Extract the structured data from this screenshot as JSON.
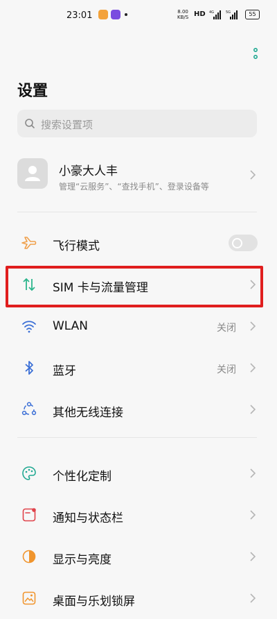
{
  "status_bar": {
    "time": "23:01",
    "speed_value": "8.00",
    "speed_unit": "KB/S",
    "hd": "HD",
    "signal1": "4G",
    "signal2": "5G",
    "battery": "55"
  },
  "page": {
    "title": "设置"
  },
  "search": {
    "placeholder": "搜索设置项"
  },
  "account": {
    "name": "小豪大人丰",
    "subtitle": "管理“云服务”、“查找手机”、登录设备等"
  },
  "settings": {
    "airplane": {
      "label": "飞行模式",
      "icon": "airplane-icon"
    },
    "sim": {
      "label": "SIM 卡与流量管理",
      "icon": "sim-data-icon"
    },
    "wlan": {
      "label": "WLAN",
      "value": "关闭",
      "icon": "wifi-icon"
    },
    "bluetooth": {
      "label": "蓝牙",
      "value": "关闭",
      "icon": "bluetooth-icon"
    },
    "other_wireless": {
      "label": "其他无线连接",
      "icon": "connections-icon"
    },
    "personalize": {
      "label": "个性化定制",
      "icon": "palette-icon"
    },
    "notifications": {
      "label": "通知与状态栏",
      "icon": "notification-icon"
    },
    "display": {
      "label": "显示与亮度",
      "icon": "brightness-icon"
    },
    "desktop": {
      "label": "桌面与乐划锁屏",
      "icon": "wallpaper-icon"
    }
  },
  "colors": {
    "highlight": "#e01e1e",
    "airplane": "#f0a04b",
    "sim": "#2bb58c",
    "blue": "#3b6fd6",
    "teal": "#1fa891",
    "notify": "#e0424a",
    "display": "#f0952e"
  }
}
